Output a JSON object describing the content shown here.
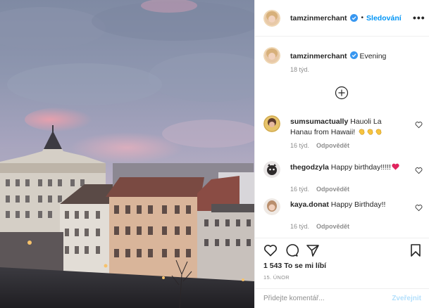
{
  "post": {
    "image_alt": "Evening sky over Prague rooftops",
    "header": {
      "username": "tamzinmerchant",
      "dot": "•",
      "follow_label": "Sledování",
      "more_label": "•••"
    },
    "caption": {
      "username": "tamzinmerchant",
      "text": "Evening",
      "time": "18 týd."
    },
    "comments": [
      {
        "username": "sumsumactually",
        "text": "Hauoli La Hanau from Hawaii!",
        "emoji": [
          "hand-emoji",
          "hand-emoji",
          "hand-emoji"
        ],
        "time": "16 týd.",
        "reply_label": "Odpovědět"
      },
      {
        "username": "thegodzyla",
        "text": "Happy birthday!!!!!",
        "emoji": [
          "red-heart-emoji"
        ],
        "time": "16 týd.",
        "reply_label": "Odpovědět"
      },
      {
        "username": "kaya.donat",
        "text": "Happy Birthday!!",
        "emoji": [],
        "time": "16 týd.",
        "reply_label": "Odpovědět"
      }
    ],
    "likes": "1 543 To se mi líbí",
    "date": "15. ÚNOR",
    "add_comment": {
      "placeholder": "Přidejte komentář...",
      "post_label": "Zveřejnit"
    }
  },
  "colors": {
    "link_blue": "#0095f6",
    "post_disabled": "#b2dffc",
    "muted": "#8e8e8e",
    "text": "#262626",
    "heart_red": "#ed4956",
    "verified_blue": "#3897f0"
  }
}
